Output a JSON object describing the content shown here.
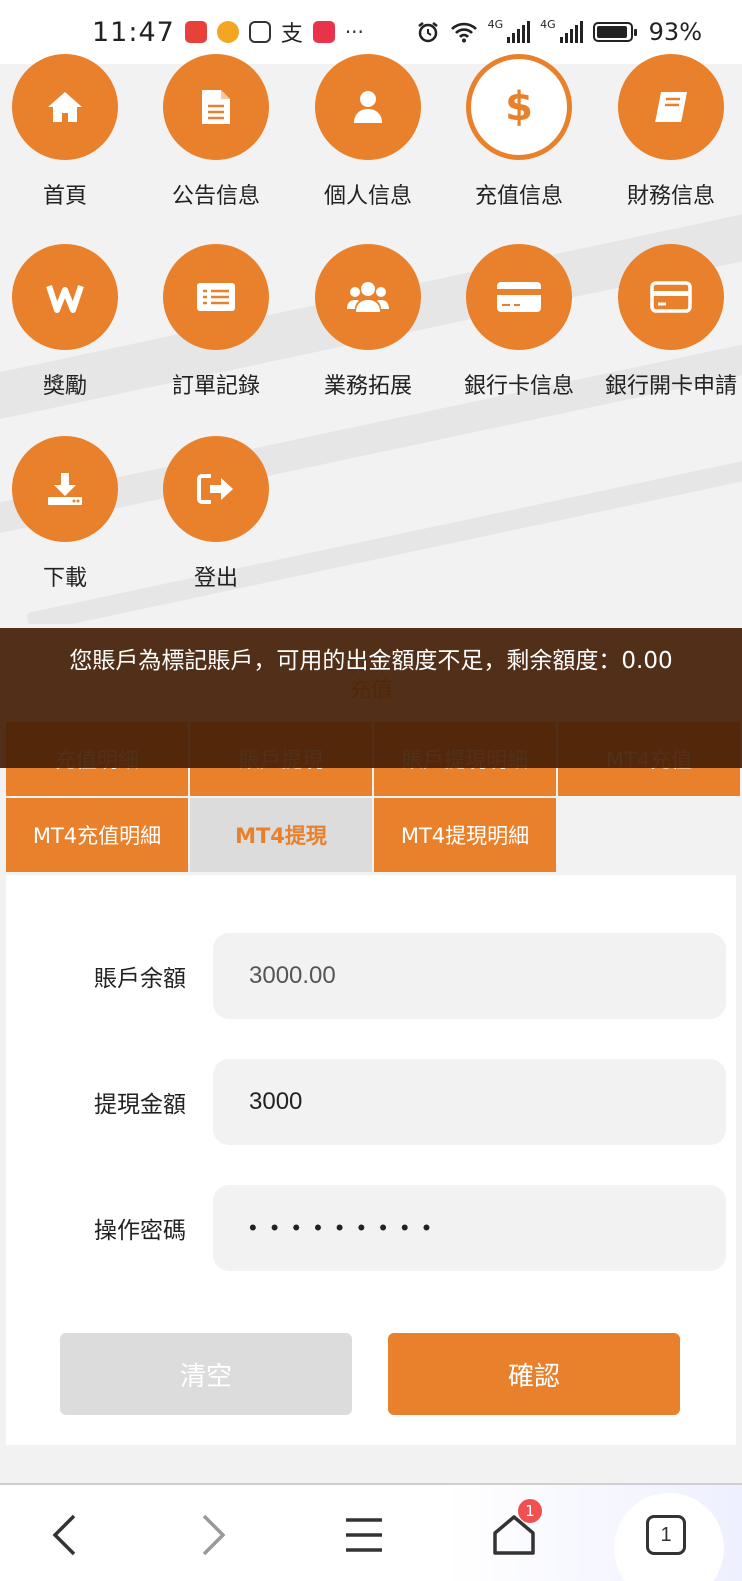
{
  "status_bar": {
    "time": "11:47",
    "more": "···",
    "battery": "93%",
    "network": "4G",
    "icons": [
      "alarm-icon",
      "wifi-icon",
      "signal-icon",
      "signal-icon",
      "battery-icon"
    ]
  },
  "menu": {
    "items": [
      {
        "label": "首頁",
        "icon": "home-icon"
      },
      {
        "label": "公告信息",
        "icon": "document-icon"
      },
      {
        "label": "個人信息",
        "icon": "user-icon"
      },
      {
        "label": "充值信息",
        "icon": "dollar-icon"
      },
      {
        "label": "財務信息",
        "icon": "book-icon"
      },
      {
        "label": "獎勵",
        "icon": "reward-icon"
      },
      {
        "label": "訂單記錄",
        "icon": "list-icon"
      },
      {
        "label": "業務拓展",
        "icon": "group-icon"
      },
      {
        "label": "銀行卡信息",
        "icon": "card-icon"
      },
      {
        "label": "銀行開卡申請",
        "icon": "card-apply-icon"
      },
      {
        "label": "下載",
        "icon": "download-icon"
      },
      {
        "label": "登出",
        "icon": "logout-icon"
      }
    ]
  },
  "toast": {
    "message": "您賬戶為標記賬戶，可用的出金額度不足，剩余額度：0.00"
  },
  "section_title": "充值",
  "tabs": [
    {
      "label": "充值明細",
      "active": false
    },
    {
      "label": "賬戶提現",
      "active": false
    },
    {
      "label": "賬戶提現明細",
      "active": false
    },
    {
      "label": "MT4充值",
      "active": false
    },
    {
      "label": "MT4充值明細",
      "active": false
    },
    {
      "label": "MT4提現",
      "active": true
    },
    {
      "label": "MT4提現明細",
      "active": false
    }
  ],
  "form": {
    "balance_label": "賬戶余額",
    "balance_value": "3000.00",
    "amount_label": "提現金額",
    "amount_value": "3000",
    "password_label": "操作密碼",
    "password_value": "•••••••••",
    "clear_label": "清空",
    "confirm_label": "確認"
  },
  "browser": {
    "tab_count": "1",
    "home_badge": "1"
  },
  "colors": {
    "accent": "#e9802b",
    "toast_bg": "#46200a",
    "disabled": "#dcdcdc"
  }
}
